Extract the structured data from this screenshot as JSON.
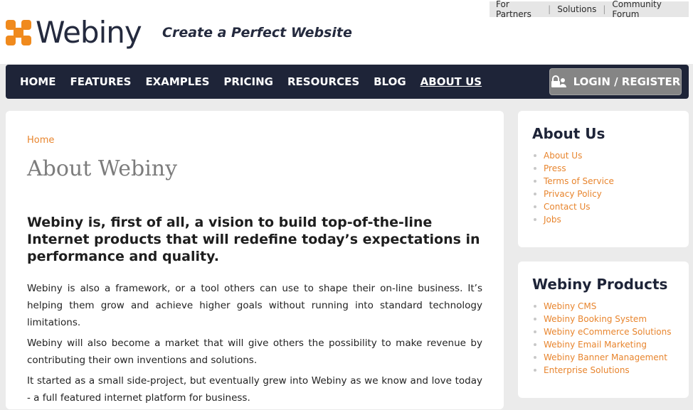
{
  "top_links": [
    "For Partners",
    "Solutions",
    "Community Forum"
  ],
  "logo_text": "Webiny",
  "tagline": "Create a Perfect Website",
  "nav": {
    "items": [
      "HOME",
      "FEATURES",
      "EXAMPLES",
      "PRICING",
      "RESOURCES",
      "BLOG",
      "ABOUT US"
    ],
    "active": "ABOUT US",
    "login_label": "LOGIN / REGISTER"
  },
  "main": {
    "breadcrumb": "Home",
    "title": "About Webiny",
    "lead": "Webiny is, first of all, a vision to build top-of-the-line Internet products that will redefine today’s expectations in performance and quality.",
    "paragraphs": [
      "Webiny is also a framework, or a tool others can use to shape their on-line business. It’s helping them grow and achieve higher goals without running into standard technology limitations.",
      "Webiny will also become a market that will give others the possibility to make revenue by contributing their own inventions and solutions.",
      "It started as a small side-project, but eventually grew into Webiny as we know and love today - a full featured internet platform for business."
    ]
  },
  "sidebar": {
    "about": {
      "title": "About Us",
      "items": [
        "About Us",
        "Press",
        "Terms of Service",
        "Privacy Policy",
        "Contact Us",
        "Jobs"
      ]
    },
    "products": {
      "title": "Webiny Products",
      "items": [
        "Webiny CMS",
        "Webiny Booking System",
        "Webiny eCommerce Solutions",
        "Webiny Email Marketing",
        "Webiny Banner Management",
        "Enterprise Solutions"
      ]
    }
  },
  "colors": {
    "accent_orange": "#e8852e",
    "nav_dark": "#1e2438",
    "login_gray": "#858585",
    "page_bg": "#ebebeb"
  },
  "icons": {
    "logo": "webiny-logo-icon",
    "login": "lock-user-icon"
  }
}
